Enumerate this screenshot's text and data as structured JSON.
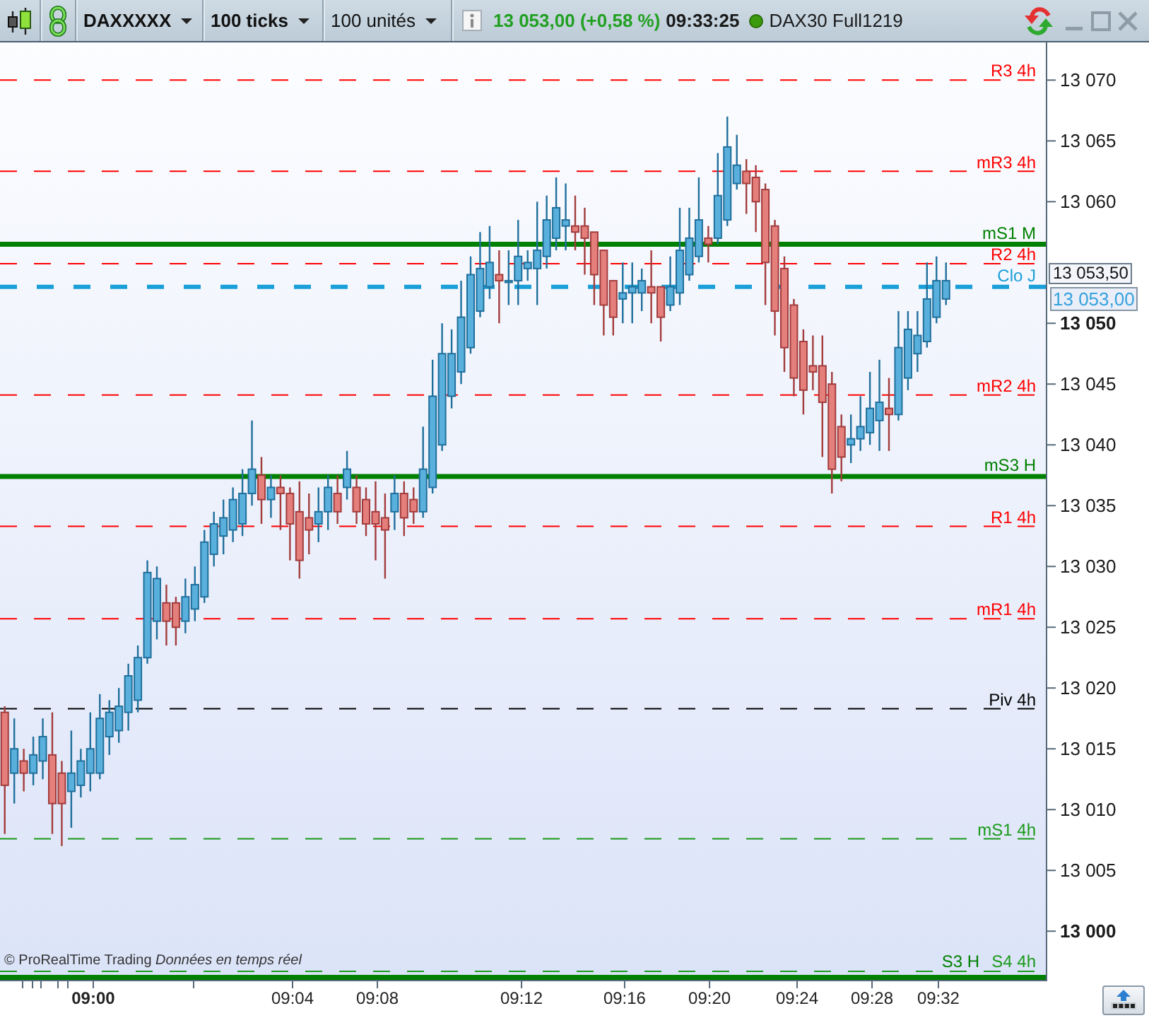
{
  "toolbar": {
    "instrument": "DAXXXXX",
    "interval": "100 ticks",
    "units": "100 unités",
    "quote": "13 053,00 (+0,58 %)",
    "time": "09:33:25",
    "feed": {
      "label": "DAX30 Full1219",
      "connected": true
    }
  },
  "chart": {
    "chart_data": {
      "type": "candlestick",
      "categories": [
        null,
        null,
        null,
        null,
        null,
        null,
        null,
        null,
        null,
        null,
        null,
        null,
        null,
        null,
        null,
        null,
        null,
        null,
        null,
        null,
        null,
        null,
        null,
        null,
        null,
        null,
        null,
        null,
        null,
        null,
        null,
        null,
        null,
        null,
        null,
        null,
        null,
        null,
        null,
        null,
        null,
        null,
        null,
        null,
        null,
        null,
        null,
        null,
        null,
        null,
        null,
        null,
        null,
        null,
        null,
        null,
        null,
        null,
        null,
        null,
        null,
        null,
        null,
        null,
        null,
        null,
        null,
        null,
        null,
        null,
        null,
        null,
        null,
        null,
        null,
        null,
        null,
        null,
        null,
        null,
        null,
        null,
        null,
        null,
        null,
        null,
        null,
        null,
        null,
        null,
        null,
        null,
        null,
        null,
        null,
        null,
        null,
        null,
        null,
        null,
        null,
        null,
        null,
        null,
        null,
        null,
        null,
        null,
        null,
        null
      ],
      "ohlc": [
        [
          13018,
          13018.5,
          13008,
          13012
        ],
        [
          13013,
          13017.5,
          13010.5,
          13015
        ],
        [
          13014,
          13015,
          13011.5,
          13013
        ],
        [
          13013,
          13016,
          13012,
          13014.5
        ],
        [
          13014,
          13017.5,
          13012.5,
          13016
        ],
        [
          13014.5,
          13018,
          13008,
          13010.5
        ],
        [
          13013,
          13014,
          13007,
          13010.5
        ],
        [
          13011.5,
          13016.5,
          13008.5,
          13013
        ],
        [
          13012,
          13015,
          13011,
          13014
        ],
        [
          13013,
          13018,
          13011.5,
          13015
        ],
        [
          13013,
          13019.5,
          13012.5,
          13017.5
        ],
        [
          13016,
          13019,
          13014.5,
          13018
        ],
        [
          13016.5,
          13020,
          13015.5,
          13018.5
        ],
        [
          13018,
          13022,
          13016.5,
          13021
        ],
        [
          13019,
          13023.5,
          13018,
          13022.5
        ],
        [
          13022.5,
          13030.5,
          13022,
          13029.5
        ],
        [
          13025.5,
          13030,
          13024,
          13029
        ],
        [
          13027,
          13028.5,
          13023.5,
          13025.5
        ],
        [
          13027,
          13027.5,
          13023.5,
          13025
        ],
        [
          13025.5,
          13029,
          13024.5,
          13027.5
        ],
        [
          13026.5,
          13030,
          13025.5,
          13028.5
        ],
        [
          13027.5,
          13033,
          13027,
          13032
        ],
        [
          13031,
          13034.5,
          13030,
          13033.5
        ],
        [
          13032.5,
          13035.5,
          13031,
          13034
        ],
        [
          13033,
          13036.5,
          13032,
          13035.5
        ],
        [
          13033.5,
          13038,
          13032.5,
          13036
        ],
        [
          13036,
          13042,
          13035,
          13038
        ],
        [
          13037.5,
          13039,
          13033.5,
          13035.5
        ],
        [
          13035.5,
          13037.5,
          13034,
          13036.5
        ],
        [
          13036.5,
          13037.5,
          13033,
          13036
        ],
        [
          13036,
          13036.5,
          13030.5,
          13033.5
        ],
        [
          13034.5,
          13037,
          13029,
          13030.5
        ],
        [
          13034,
          13036,
          13031,
          13033
        ],
        [
          13033.5,
          13036.5,
          13032,
          13034.5
        ],
        [
          13034.5,
          13037.5,
          13033,
          13036.5
        ],
        [
          13036,
          13037.5,
          13033.5,
          13034.5
        ],
        [
          13036.5,
          13039.5,
          13035.5,
          13038
        ],
        [
          13036.5,
          13037.5,
          13033.5,
          13034.5
        ],
        [
          13035.5,
          13036.5,
          13032.5,
          13033.5
        ],
        [
          13034.5,
          13037,
          13030.5,
          13033.5
        ],
        [
          13034,
          13036,
          13029,
          13033
        ],
        [
          13034.5,
          13037.5,
          13033,
          13036
        ],
        [
          13036,
          13037,
          13032.5,
          13034
        ],
        [
          13035.5,
          13036.5,
          13033.5,
          13034.5
        ],
        [
          13034.5,
          13041.5,
          13034,
          13038
        ],
        [
          13036.5,
          13047,
          13036,
          13044
        ],
        [
          13040,
          13050,
          13039.5,
          13047.5
        ],
        [
          13044,
          13049.5,
          13043,
          13047.5
        ],
        [
          13046,
          13053.5,
          13045,
          13050.5
        ],
        [
          13048,
          13055.5,
          13047.5,
          13054
        ],
        [
          13051,
          13057.5,
          13050.5,
          13054.5
        ],
        [
          13053,
          13058,
          13052,
          13055
        ],
        [
          13054,
          13056,
          13050,
          13053.5
        ],
        [
          13053.5,
          13056,
          13051.5,
          13053.5
        ],
        [
          13053.5,
          13058.5,
          13051.5,
          13055.5
        ],
        [
          13054.5,
          13056,
          13053.5,
          13055
        ],
        [
          13054.5,
          13060,
          13051.5,
          13056
        ],
        [
          13055.5,
          13060.5,
          13054.5,
          13058.5
        ],
        [
          13057,
          13062,
          13056,
          13059.5
        ],
        [
          13058,
          13061.5,
          13056,
          13058.5
        ],
        [
          13058,
          13060.5,
          13056,
          13057.5
        ],
        [
          13058,
          13059.5,
          13054,
          13057
        ],
        [
          13057.5,
          13057.5,
          13051.5,
          13054
        ],
        [
          13056,
          13056,
          13049,
          13051.5
        ],
        [
          13053.5,
          13053.5,
          13049,
          13050.5
        ],
        [
          13052,
          13055,
          13050,
          13052.5
        ],
        [
          13052.5,
          13055,
          13050,
          13053
        ],
        [
          13052.5,
          13054.5,
          13051,
          13053.5
        ],
        [
          13053,
          13056,
          13050,
          13052.5
        ],
        [
          13053,
          13053,
          13048.5,
          13050.5
        ],
        [
          13051.5,
          13055.5,
          13051,
          13053
        ],
        [
          13052.5,
          13059.5,
          13051.5,
          13056
        ],
        [
          13054,
          13059.5,
          13053.5,
          13057
        ],
        [
          13055.5,
          13062,
          13055,
          13058.5
        ],
        [
          13057,
          13058,
          13055,
          13056.5
        ],
        [
          13057,
          13064,
          13056.5,
          13060.5
        ],
        [
          13058.5,
          13067,
          13058,
          13064.5
        ],
        [
          13061.5,
          13065.5,
          13061,
          13063
        ],
        [
          13062.5,
          13063.5,
          13059,
          13061.5
        ],
        [
          13062,
          13063,
          13057.5,
          13060
        ],
        [
          13061,
          13061.5,
          13051.5,
          13055
        ],
        [
          13058,
          13058.5,
          13049,
          13051
        ],
        [
          13054.5,
          13055.5,
          13046,
          13048
        ],
        [
          13051.5,
          13052,
          13044,
          13045.5
        ],
        [
          13048.5,
          13049.5,
          13042.5,
          13044.5
        ],
        [
          13046.5,
          13049,
          13044.5,
          13046
        ],
        [
          13046.5,
          13049,
          13039,
          13043.5
        ],
        [
          13045,
          13046,
          13036,
          13038
        ],
        [
          13041.5,
          13042.5,
          13037,
          13039
        ],
        [
          13040,
          13042.5,
          13038.5,
          13040.5
        ],
        [
          13040.5,
          13044,
          13039.5,
          13041.5
        ],
        [
          13041,
          13046,
          13040,
          13043
        ],
        [
          13042,
          13047,
          13039.5,
          13043.5
        ],
        [
          13043,
          13045.5,
          13039.5,
          13042.5
        ],
        [
          13042.5,
          13051,
          13042,
          13048
        ],
        [
          13045.5,
          13051,
          13044.5,
          13049.5
        ],
        [
          13047.5,
          13051,
          13046,
          13049
        ],
        [
          13048.5,
          13055,
          13048,
          13052
        ],
        [
          13050.5,
          13055.5,
          13050,
          13053.5
        ],
        [
          13052,
          13055,
          13051.5,
          13053.5
        ],
        null,
        null,
        null,
        null,
        null,
        null,
        null,
        null,
        null,
        null
      ],
      "ylim": [
        12996,
        13073.1
      ],
      "yticks": [
        {
          "value": 13070,
          "label": "13 070"
        },
        {
          "value": 13065,
          "label": "13 065"
        },
        {
          "value": 13060,
          "label": "13 060"
        },
        {
          "value": 13050,
          "label": "13 050"
        },
        {
          "value": 13045,
          "label": "13 045"
        },
        {
          "value": 13040,
          "label": "13 040"
        },
        {
          "value": 13035,
          "label": "13 035"
        },
        {
          "value": 13030,
          "label": "13 030"
        },
        {
          "value": 13025,
          "label": "13 025"
        },
        {
          "value": 13020,
          "label": "13 020"
        },
        {
          "value": 13015,
          "label": "13 015"
        },
        {
          "value": 13010,
          "label": "13 010"
        },
        {
          "value": 13005,
          "label": "13 005"
        },
        {
          "value": 13000,
          "label": "13 000"
        }
      ],
      "ref_lines": [
        {
          "axis": "y",
          "value": 13070,
          "color": "#ff0000"
        },
        {
          "axis": "y",
          "value": 13062.5,
          "color": "#ff0000"
        },
        {
          "axis": "y",
          "value": 13056.5,
          "color": "#008000"
        },
        {
          "axis": "y",
          "value": 13054.9,
          "color": "#ff0000"
        },
        {
          "axis": "y",
          "value": 13053,
          "color": "#1a9fd8"
        },
        {
          "axis": "y",
          "value": 13044.1,
          "color": "#ff0000"
        },
        {
          "axis": "y",
          "value": 13037.4,
          "color": "#008000"
        },
        {
          "axis": "y",
          "value": 13033.3,
          "color": "#ff0000"
        },
        {
          "axis": "y",
          "value": 13025.7,
          "color": "#ff0000"
        },
        {
          "axis": "y",
          "value": 13018.3,
          "color": "#000000"
        },
        {
          "axis": "y",
          "value": 13007.6,
          "color": "#1a9a1a"
        },
        {
          "axis": "y",
          "value": 12996.2,
          "color": "#008000"
        },
        {
          "axis": "y",
          "value": 12996.7,
          "color": "#1a9a1a"
        }
      ]
    },
    "levels": [
      {
        "label": "R3 4h",
        "kind": "dashed"
      },
      {
        "label": "mR3 4h",
        "kind": "dashed"
      },
      {
        "label": "mS1 M",
        "kind": "solid"
      },
      {
        "label": "R2 4h",
        "kind": "dashed"
      },
      {
        "label": "Clo J",
        "kind": "close"
      },
      {
        "label": "mR2 4h",
        "kind": "dashed"
      },
      {
        "label": "mS3 H",
        "kind": "solid"
      },
      {
        "label": "R1 4h",
        "kind": "dashed"
      },
      {
        "label": "mR1 4h",
        "kind": "dashed"
      },
      {
        "label": "Piv 4h",
        "kind": "dashed"
      },
      {
        "label": "mS1 4h",
        "kind": "dashed"
      },
      {
        "label": "S3 H",
        "kind": "solid"
      },
      {
        "label": "S4 4h",
        "kind": "dashed"
      }
    ],
    "copyright": "© ProRealTime Trading *Données en temps réel*"
  },
  "price_axis": {
    "tags": [
      {
        "label": "13 053,50",
        "kind": "last"
      },
      {
        "label": "13 053,00",
        "kind": "close"
      }
    ]
  },
  "time_axis": {
    "labels": [
      {
        "label": "09:00",
        "bold": true
      },
      {
        "label": "09:04",
        "bold": false
      },
      {
        "label": "09:08",
        "bold": false
      },
      {
        "label": "09:12",
        "bold": false
      },
      {
        "label": "09:16",
        "bold": false
      },
      {
        "label": "09:20",
        "bold": false
      },
      {
        "label": "09:24",
        "bold": false
      },
      {
        "label": "09:28",
        "bold": false
      },
      {
        "label": "09:32",
        "bold": false
      }
    ]
  }
}
